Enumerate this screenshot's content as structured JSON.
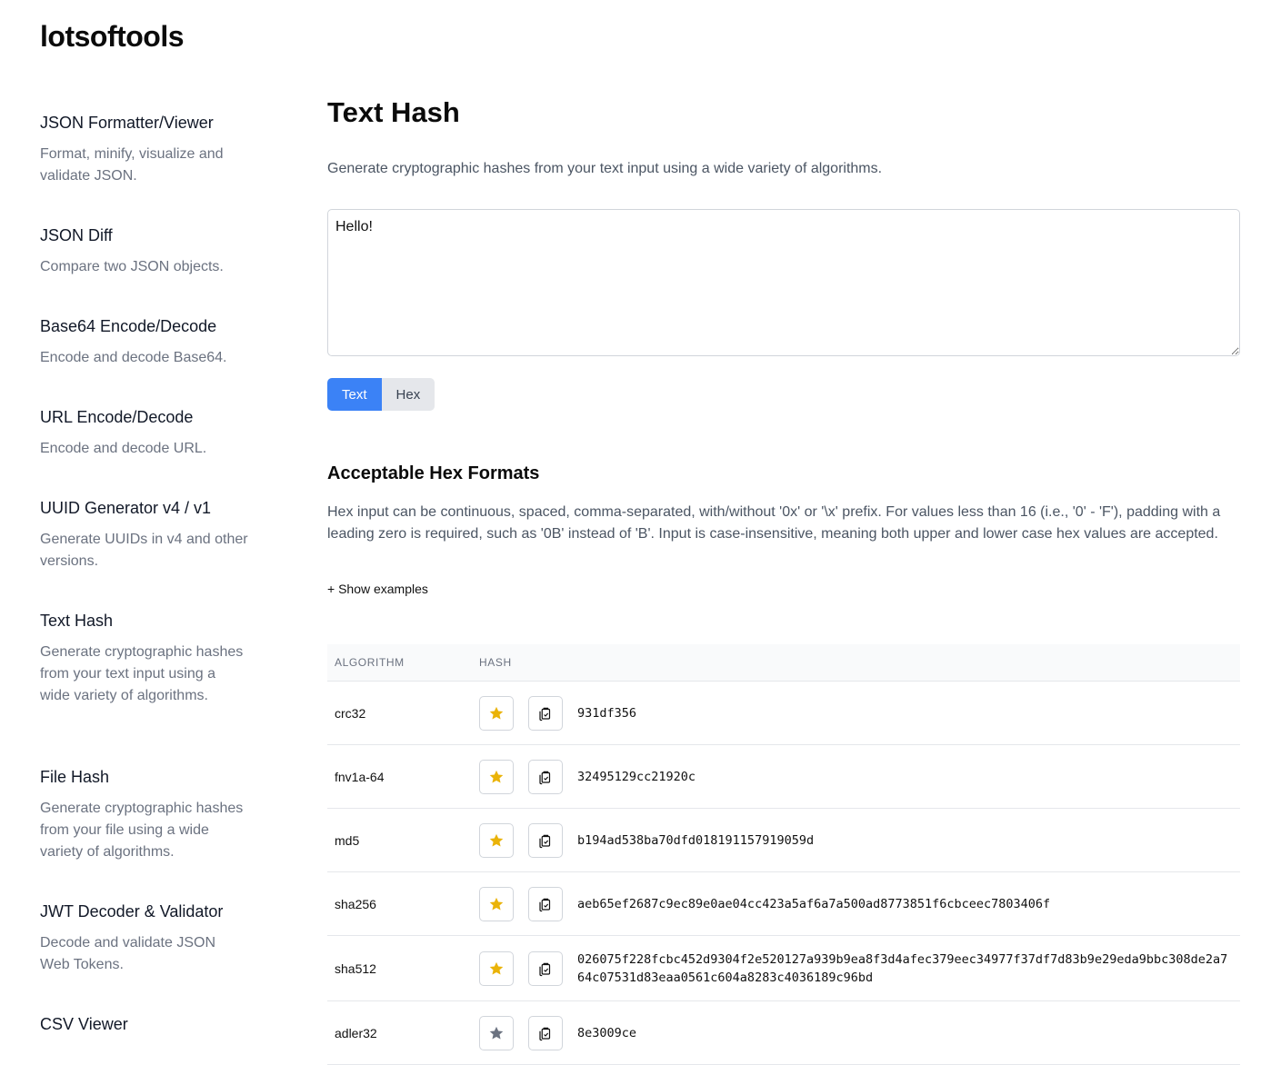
{
  "brand": "lotsoftools",
  "sidebar": {
    "items": [
      {
        "title": "JSON Formatter/Viewer",
        "desc": "Format, minify, visualize and validate JSON."
      },
      {
        "title": "JSON Diff",
        "desc": "Compare two JSON objects."
      },
      {
        "title": "Base64 Encode/Decode",
        "desc": "Encode and decode Base64."
      },
      {
        "title": "URL Encode/Decode",
        "desc": "Encode and decode URL."
      },
      {
        "title": "UUID Generator v4 / v1",
        "desc": "Generate UUIDs in v4 and other versions."
      },
      {
        "title": "Text Hash",
        "desc": "Generate cryptographic hashes from your text input using a wide variety of algorithms."
      },
      {
        "title": "File Hash",
        "desc": "Generate cryptographic hashes from your file using a wide variety of algorithms."
      },
      {
        "title": "JWT Decoder & Validator",
        "desc": "Decode and validate JSON Web Tokens."
      },
      {
        "title": "CSV Viewer",
        "desc": ""
      }
    ]
  },
  "main": {
    "title": "Text Hash",
    "description": "Generate cryptographic hashes from your text input using a wide variety of algorithms.",
    "input_value": "Hello!",
    "mode_buttons": {
      "text": "Text",
      "hex": "Hex"
    },
    "hex_section": {
      "title": "Acceptable Hex Formats",
      "body": "Hex input can be continuous, spaced, comma-separated, with/without '0x' or '\\x' prefix. For values less than 16 (i.e., '0' - 'F'), padding with a leading zero is required, such as '0B' instead of 'B'. Input is case-insensitive, meaning both upper and lower case hex values are accepted.",
      "toggle": "+ Show examples"
    },
    "table": {
      "headers": {
        "algorithm": "ALGORITHM",
        "hash": "HASH"
      },
      "rows": [
        {
          "algorithm": "crc32",
          "hash": "931df356",
          "starred": true
        },
        {
          "algorithm": "fnv1a-64",
          "hash": "32495129cc21920c",
          "starred": true
        },
        {
          "algorithm": "md5",
          "hash": "b194ad538ba70dfd018191157919059d",
          "starred": true
        },
        {
          "algorithm": "sha256",
          "hash": "aeb65ef2687c9ec89e0ae04cc423a5af6a7a500ad8773851f6cbceec7803406f",
          "starred": true
        },
        {
          "algorithm": "sha512",
          "hash": "026075f228fcbc452d9304f2e520127a939b9ea8f3d4afec379eec34977f37df7d83b9e29eda9bbc308de2a764c07531d83eaa0561c604a8283c4036189c96bd",
          "starred": true
        },
        {
          "algorithm": "adler32",
          "hash": "8e3009ce",
          "starred": false
        }
      ]
    }
  },
  "colors": {
    "accent": "#3b82f6",
    "star_active": "#eab308",
    "star_inactive": "#6b7280"
  }
}
